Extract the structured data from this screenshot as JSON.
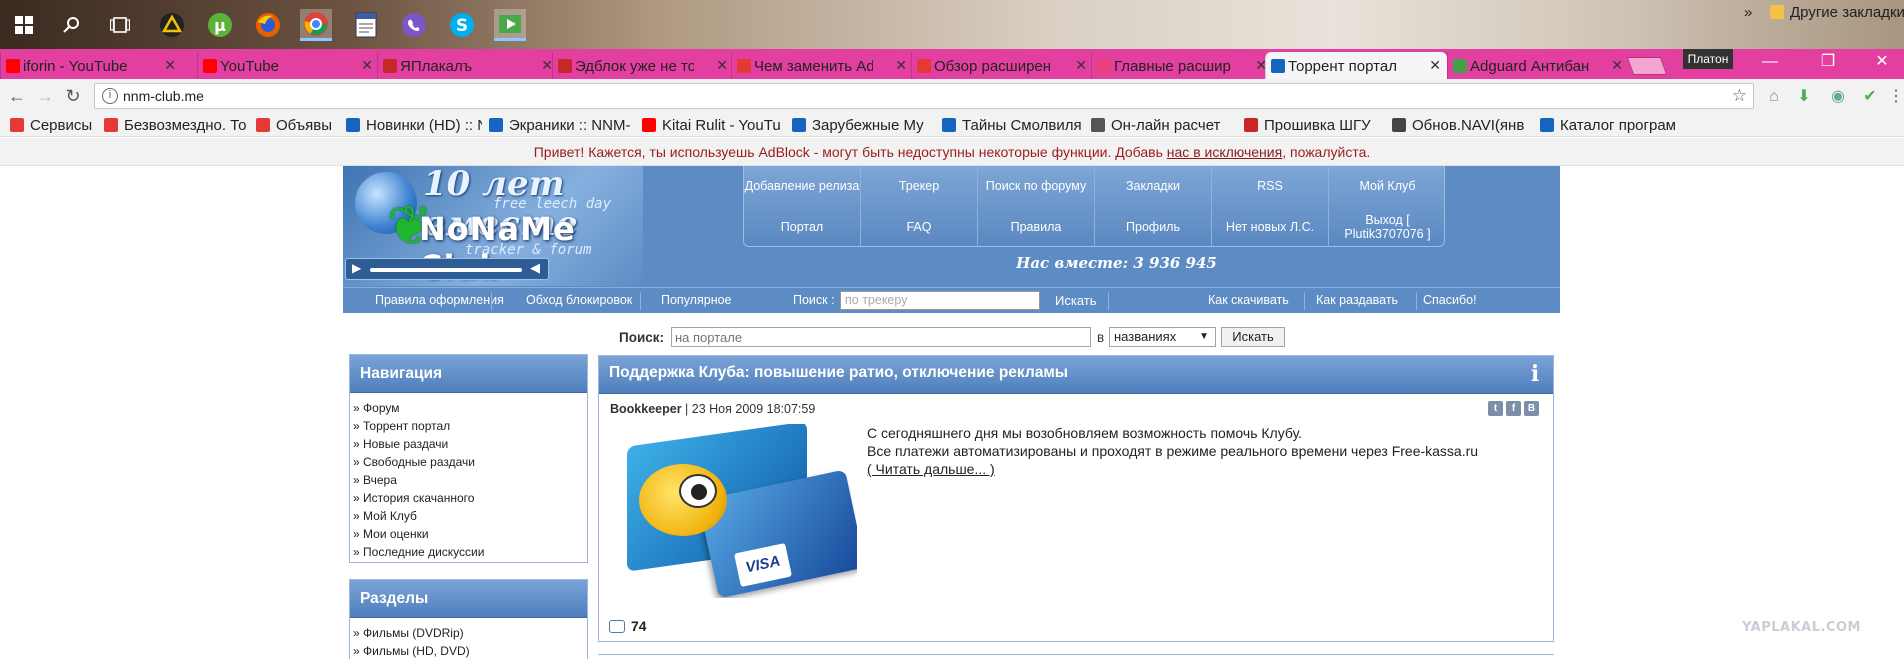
{
  "taskbar": {
    "icons": [
      "windows-start-icon",
      "search-icon",
      "task-view-icon",
      "warning-triangle-icon",
      "utorrent-icon",
      "firefox-icon",
      "chrome-icon",
      "notes-icon",
      "viber-icon",
      "skype-icon",
      "media-player-icon"
    ]
  },
  "browser": {
    "tabs": [
      {
        "title": "iforin - YouTube",
        "color": "#ff0000"
      },
      {
        "title": "YouTube",
        "color": "#ff0000"
      },
      {
        "title": "ЯПлакалъ",
        "color": "#c62828"
      },
      {
        "title": "Эдблок уже не то",
        "color": "#c62828"
      },
      {
        "title": "Чем заменить Ad",
        "color": "#e53935"
      },
      {
        "title": "Обзор расширен",
        "color": "#e53935"
      },
      {
        "title": "Главные расшир",
        "color": "#ec407a"
      },
      {
        "title": "Торрент портал",
        "color": "#1565c0"
      },
      {
        "title": "Adguard Антибан",
        "color": "#43a047"
      }
    ],
    "active_tab": 7,
    "profile": "Платон",
    "url": "nnm-club.me",
    "bookmarks": [
      {
        "label": "Сервисы",
        "color": "#e53935"
      },
      {
        "label": "Безвозмездно. То",
        "color": "#e53935"
      },
      {
        "label": "Объявы",
        "color": "#e53935"
      },
      {
        "label": "Новинки (HD) :: N",
        "color": "#1565c0"
      },
      {
        "label": "Экраники :: NNM-",
        "color": "#1565c0"
      },
      {
        "label": "Kitai Rulit - YouTu",
        "color": "#ff0000"
      },
      {
        "label": "Зарубежные Му",
        "color": "#1565c0"
      },
      {
        "label": "Тайны Смолвиля",
        "color": "#1565c0"
      },
      {
        "label": "Он-лайн расчет",
        "color": "#555555"
      },
      {
        "label": "Прошивка ШГУ",
        "color": "#c62828"
      },
      {
        "label": "Обнов.NAVI(янв",
        "color": "#444444"
      },
      {
        "label": "Каталог програм",
        "color": "#1565c0"
      }
    ],
    "bookmarks_overflow": "»",
    "other_bookmarks": "Другие закладки"
  },
  "adblock_notice": {
    "text_before": "Привет! Кажется, ты используешь AdBlock - могут быть недоступны некоторые функции. Добавь ",
    "link": "нас в исключения",
    "text_after": ", пожалуйста."
  },
  "site": {
    "logo": {
      "line1": "10 лет вместе",
      "line2": "free leech day",
      "line3": "NoNaMe Club",
      "line4": "tracker & forum"
    },
    "menu": [
      [
        "Добавление релиза",
        "Трекер",
        "Поиск по форуму",
        "Закладки",
        "RSS",
        "Мой Клуб"
      ],
      [
        "Портал",
        "FAQ",
        "Правила",
        "Профиль",
        "Нет новых Л.С.",
        "Выход [ Plutik3707076 ]"
      ]
    ],
    "together": "Нас вместе: 3 936 945",
    "subnav": {
      "left": [
        "Правила оформления",
        "Обход блокировок",
        "Популярное"
      ],
      "search_label": "Поиск :",
      "search_placeholder": "по трекеру",
      "search_button": "Искать",
      "right": [
        "Как скачивать",
        "Как раздавать",
        "Спасибо!"
      ]
    },
    "portal_search": {
      "label": "Поиск:",
      "placeholder": "на портале",
      "in": "в",
      "scope": "названиях",
      "button": "Искать"
    },
    "navigation": {
      "title": "Навигация",
      "items": [
        "Форум",
        "Торрент портал",
        "Новые раздачи",
        "Свободные раздачи",
        "Вчера",
        "История скачанного",
        "Мой Клуб",
        "Мои оценки",
        "Последние дискуссии"
      ]
    },
    "sections": {
      "title": "Разделы",
      "items": [
        "Фильмы (DVDRip)",
        "Фильмы (HD, DVD)"
      ]
    },
    "post": {
      "title": "Поддержка Клуба: повышение ратио, отключение рекламы",
      "author": "Bookkeeper",
      "date": "23 Ноя 2009 18:07:59",
      "social": [
        "t",
        "f",
        "B"
      ],
      "line1": "С сегодняшнего дня мы возобновляем возможность помочь Клубу.",
      "line2": "Все платежи автоматизированы и проходят в режиме реального времени через Free-kassa.ru",
      "more": "( Читать дальше... )",
      "comments": "74",
      "card_text": "VISA"
    }
  },
  "watermark": "YAPLAKAL.COM"
}
